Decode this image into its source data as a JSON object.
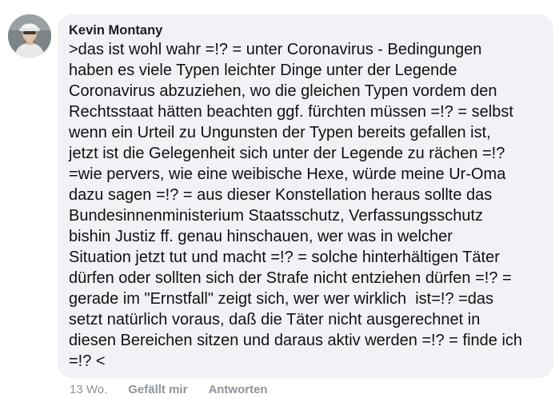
{
  "comment": {
    "author": "Kevin Montany",
    "avatar_icon": "profile-photo-avatar",
    "lines": [
      ">das ist wohl wahr =!? = unter Coronavirus - Bedingungen",
      "haben es viele Typen leichter Dinge unter der Legende",
      "Coronavirus abzuziehen, wo die gleichen Typen vordem den",
      "Rechtsstaat hätten beachten ggf. fürchten müssen =!? = selbst",
      "wenn ein Urteil zu Ungunsten der Typen bereits gefallen ist,",
      "jetzt ist die Gelegenheit sich unter der Legende zu rächen =!?",
      "=wie pervers, wie eine weibische Hexe, würde meine Ur-Oma",
      "dazu sagen =!? = aus dieser Konstellation heraus sollte das",
      "Bundesinnenministerium Staatsschutz, Verfassungsschutz",
      "bishin Justiz ff. genau hinschauen, wer was in welcher",
      "Situation jetzt tut und macht =!? = solche hinterhältigen Täter",
      "dürfen oder sollten sich der Strafe nicht entziehen dürfen =!? =",
      "gerade im \"Ernstfall\" zeigt sich, wer wer wirklich  ist=!? =das",
      "setzt natürlich voraus, daß die Täter nicht ausgerechnet in",
      "diesen Bereichen sitzen und daraus aktiv werden =!? = finde ich",
      "=!? <"
    ],
    "timestamp": "13 Wo.",
    "like_label": "Gefällt mir",
    "reply_label": "Antworten"
  },
  "colors": {
    "bubble_background": "#f0f2f5",
    "author_text": "#1c1e21",
    "body_text": "#111111",
    "meta_text": "#8d949e"
  }
}
